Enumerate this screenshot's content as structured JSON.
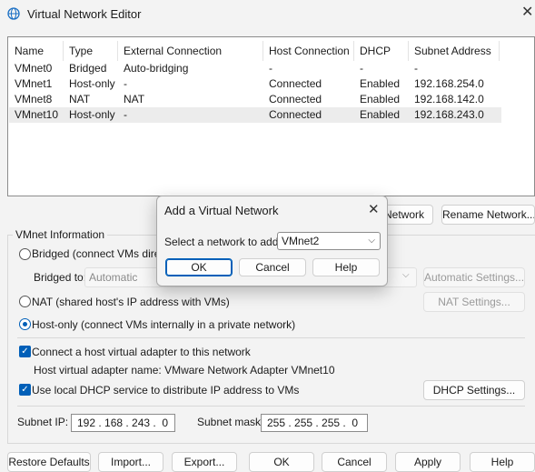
{
  "window": {
    "title": "Virtual Network Editor",
    "icon": "globe-icon",
    "close_label": "✕"
  },
  "table": {
    "headers": [
      "Name",
      "Type",
      "External Connection",
      "Host Connection",
      "DHCP",
      "Subnet Address"
    ],
    "rows": [
      [
        "VMnet0",
        "Bridged",
        "Auto-bridging",
        "-",
        "-",
        "-"
      ],
      [
        "VMnet1",
        "Host-only",
        "-",
        "Connected",
        "Enabled",
        "192.168.254.0"
      ],
      [
        "VMnet8",
        "NAT",
        "NAT",
        "Connected",
        "Enabled",
        "192.168.142.0"
      ],
      [
        "VMnet10",
        "Host-only",
        "-",
        "Connected",
        "Enabled",
        "192.168.243.0"
      ]
    ],
    "selected_row": 3
  },
  "network_buttons": {
    "add_partial": "Network",
    "rename": "Rename Network..."
  },
  "info": {
    "group_title": "VMnet Information",
    "bridged_label": "Bridged (connect VMs directl",
    "bridged_to_label": "Bridged to:",
    "bridged_to_value": "Automatic",
    "automatic_settings": "Automatic Settings...",
    "nat_label": "NAT (shared host's IP address with VMs)",
    "nat_settings": "NAT Settings...",
    "hostonly_label": "Host-only (connect VMs internally in a private network)",
    "connect_adapter_label": "Connect a host virtual adapter to this network",
    "adapter_name_label": "Host virtual adapter name: VMware Network Adapter VMnet10",
    "dhcp_label": "Use local DHCP service to distribute IP address to VMs",
    "dhcp_settings": "DHCP Settings...",
    "subnet_ip_label": "Subnet IP:",
    "subnet_ip_value": "192 . 168 . 243 .  0",
    "subnet_mask_label": "Subnet mask:",
    "subnet_mask_value": "255 . 255 . 255 .  0"
  },
  "footer": {
    "restore_defaults": "Restore Defaults",
    "import": "Import...",
    "export": "Export...",
    "ok": "OK",
    "cancel": "Cancel",
    "apply": "Apply",
    "help": "Help"
  },
  "modal": {
    "title": "Add a Virtual Network",
    "close_label": "✕",
    "select_label": "Select a network to add:",
    "select_value": "VMnet2",
    "ok": "OK",
    "cancel": "Cancel",
    "help": "Help"
  },
  "colors": {
    "accent": "#005fb8",
    "selected_row": "#ececec"
  }
}
